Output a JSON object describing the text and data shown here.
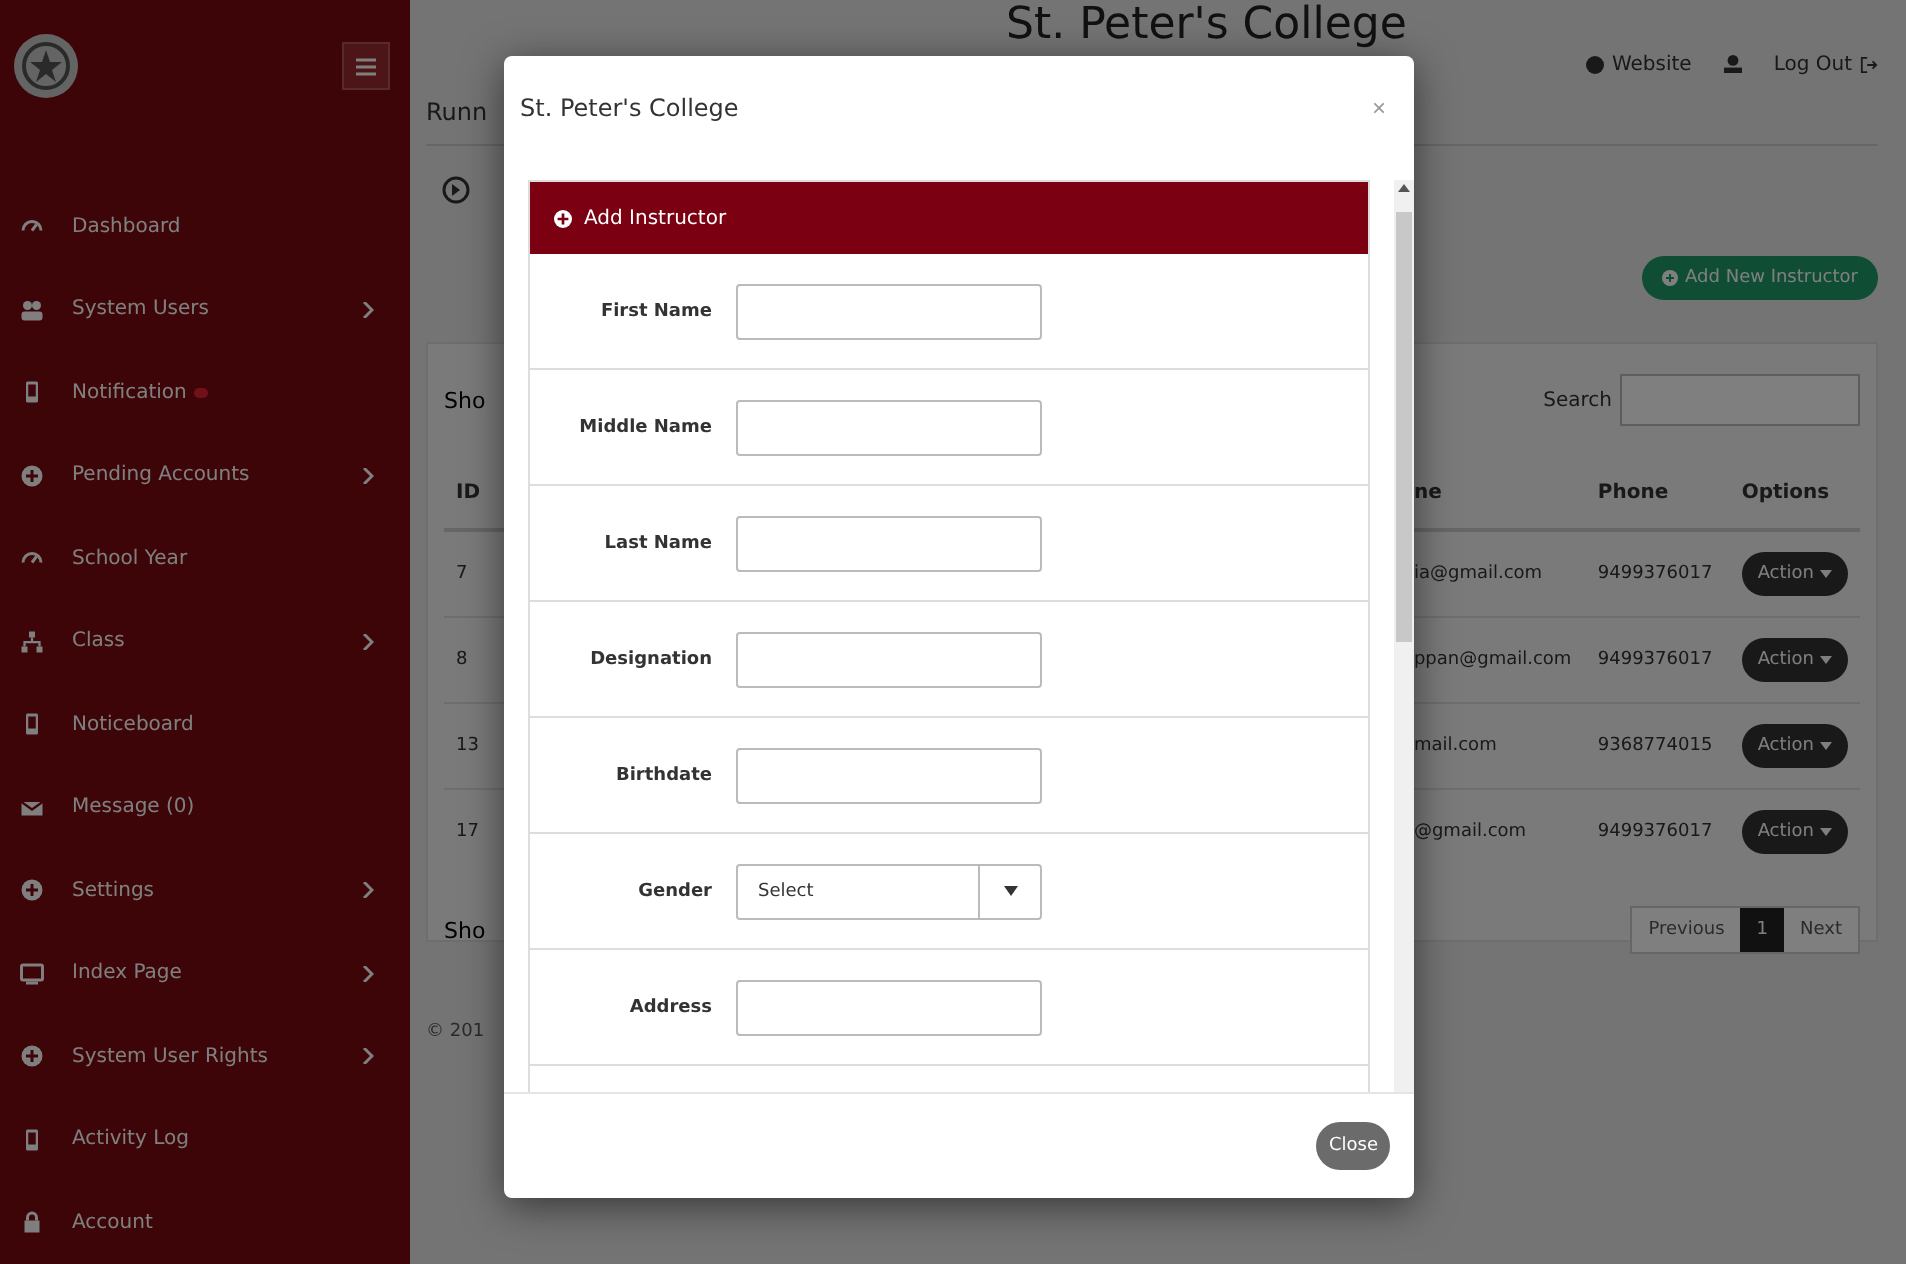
{
  "sidebar": {
    "items": [
      {
        "label": "Dashboard",
        "has_submenu": false,
        "alert": false
      },
      {
        "label": "System Users",
        "has_submenu": true,
        "alert": false
      },
      {
        "label": "Notification",
        "has_submenu": false,
        "alert": true
      },
      {
        "label": "Pending Accounts",
        "has_submenu": true,
        "alert": false
      },
      {
        "label": "School Year",
        "has_submenu": false,
        "alert": false
      },
      {
        "label": "Class",
        "has_submenu": true,
        "alert": false
      },
      {
        "label": "Noticeboard",
        "has_submenu": false,
        "alert": false
      },
      {
        "label": "Message (0)",
        "has_submenu": false,
        "alert": false
      },
      {
        "label": "Settings",
        "has_submenu": true,
        "alert": false
      },
      {
        "label": "Index Page",
        "has_submenu": true,
        "alert": false
      },
      {
        "label": "System User Rights",
        "has_submenu": true,
        "alert": false
      },
      {
        "label": "Activity Log",
        "has_submenu": false,
        "alert": false
      },
      {
        "label": "Account",
        "has_submenu": false,
        "alert": false
      }
    ]
  },
  "header": {
    "title": "St. Peter's College",
    "breadcrumb": "Runn",
    "links": [
      "Website",
      "Log Out"
    ]
  },
  "page": {
    "add_button": "Add New Instructor",
    "show_top": "Sho",
    "show_bottom": "Sho",
    "search_label": "Search",
    "footer": "© 201"
  },
  "table": {
    "columns": [
      "ID",
      "ne",
      "Phone",
      "Options"
    ],
    "rows": [
      {
        "id": "7",
        "email": "ia@gmail.com",
        "phone": "9499376017",
        "action": "Action"
      },
      {
        "id": "8",
        "email": "ppan@gmail.com",
        "phone": "9499376017",
        "action": "Action"
      },
      {
        "id": "13",
        "email": "mail.com",
        "phone": "9368774015",
        "action": "Action"
      },
      {
        "id": "17",
        "email": "@gmail.com",
        "phone": "9499376017",
        "action": "Action"
      }
    ]
  },
  "pagination": [
    {
      "label": "Previous",
      "selected": false
    },
    {
      "label": "1",
      "selected": true
    },
    {
      "label": "Next",
      "selected": false
    }
  ],
  "modal": {
    "title": "St. Peter's College",
    "close_x": "×",
    "panel_title": "Add Instructor",
    "fields": [
      {
        "label": "First Name",
        "kind": "text"
      },
      {
        "label": "Middle Name",
        "kind": "text"
      },
      {
        "label": "Last Name",
        "kind": "text"
      },
      {
        "label": "Designation",
        "kind": "text"
      },
      {
        "label": "Birthdate",
        "kind": "text"
      },
      {
        "label": "Gender",
        "kind": "select",
        "value": "Select"
      },
      {
        "label": "Address",
        "kind": "text"
      }
    ],
    "close_button": "Close"
  }
}
